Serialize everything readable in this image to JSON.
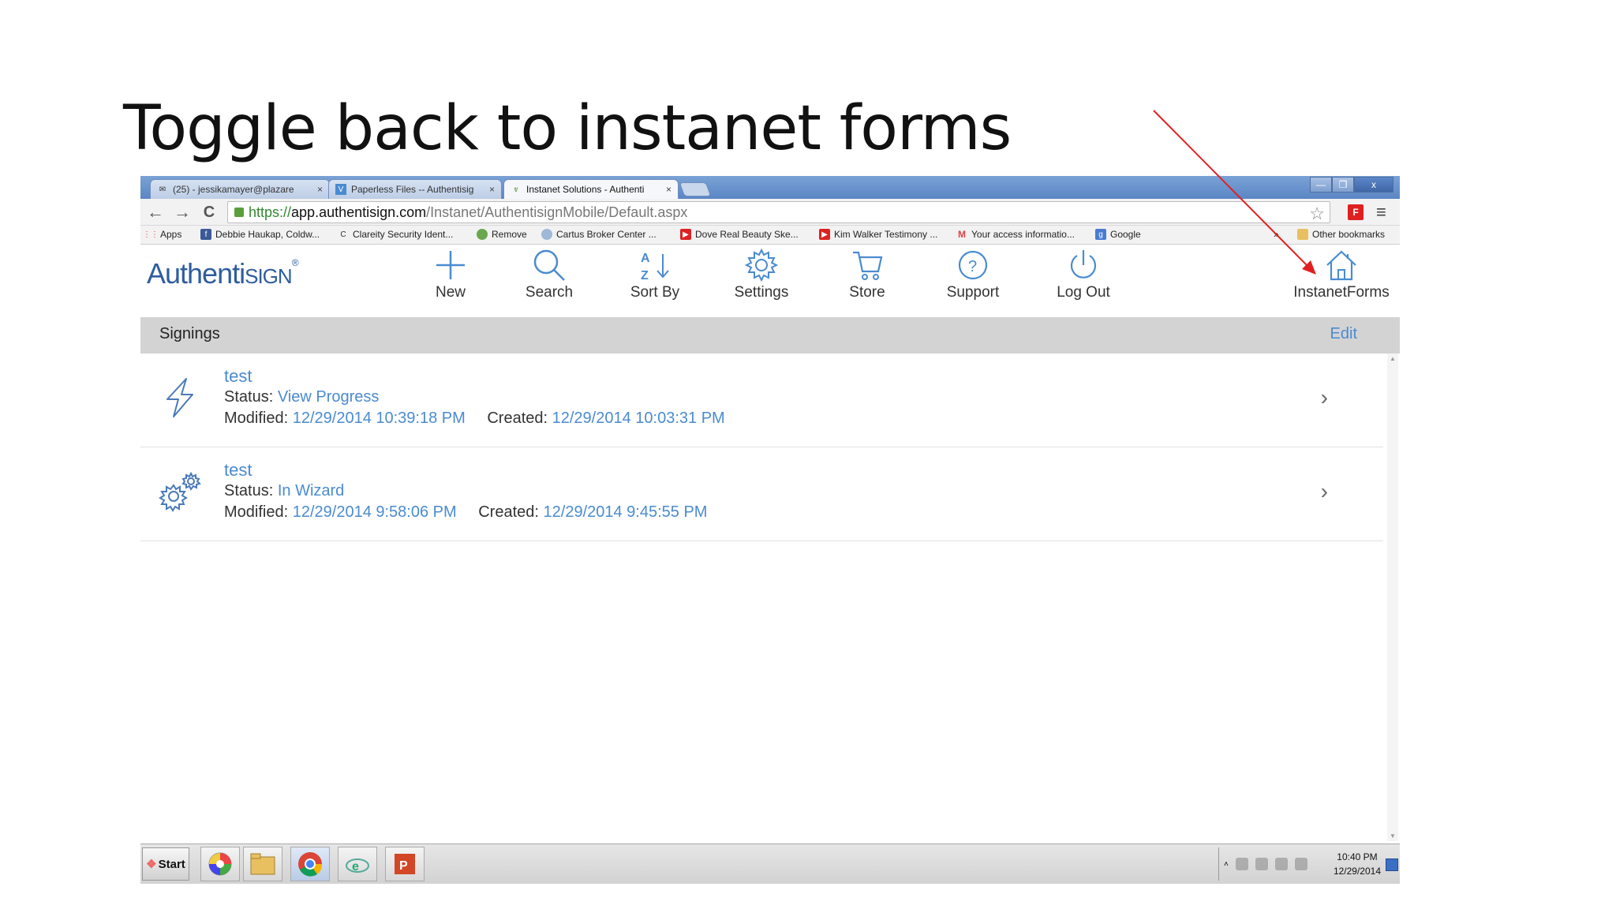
{
  "slide": {
    "title": "Toggle back to instanet forms"
  },
  "browser": {
    "tabs": [
      {
        "label": "(25) - jessikamayer@plazare",
        "close": "×"
      },
      {
        "label": "Paperless Files -- Authentisig",
        "close": "×"
      },
      {
        "label": "Instanet Solutions - Authenti",
        "close": "×"
      }
    ],
    "window_controls": {
      "minimize": "—",
      "restore": "❐",
      "close": "x"
    },
    "nav": {
      "back": "←",
      "forward": "→",
      "reload": "C"
    },
    "url": {
      "protocol": "https://",
      "host": "app.authentisign.com",
      "path": "/Instanet/AuthentisignMobile/Default.aspx"
    },
    "bookmarks": [
      "Apps",
      "Debbie Haukap, Coldw...",
      "Clareity Security Ident...",
      "Remove",
      "Cartus Broker Center ...",
      "Dove Real Beauty Ske...",
      "Kim Walker Testimony ...",
      "Your access informatio...",
      "Google"
    ],
    "bookmarks_overflow": "»",
    "other_bookmarks": "Other bookmarks"
  },
  "app": {
    "logo_main": "Authenti",
    "logo_sign": "SIGN",
    "nav": [
      {
        "label": "New",
        "icon": "plus-icon"
      },
      {
        "label": "Search",
        "icon": "search-icon"
      },
      {
        "label": "Sort By",
        "icon": "sort-az-icon"
      },
      {
        "label": "Settings",
        "icon": "gear-icon"
      },
      {
        "label": "Store",
        "icon": "cart-icon"
      },
      {
        "label": "Support",
        "icon": "help-icon"
      },
      {
        "label": "Log Out",
        "icon": "power-icon"
      },
      {
        "label": "InstanetForms",
        "icon": "home-icon"
      }
    ],
    "signings_title": "Signings",
    "edit_label": "Edit",
    "signings": [
      {
        "name": "test",
        "status_label": "Status:",
        "status": "View Progress",
        "modified_label": "Modified:",
        "modified": "12/29/2014 10:39:18 PM",
        "created_label": "Created:",
        "created": "12/29/2014 10:03:31 PM",
        "icon": "lightning-icon"
      },
      {
        "name": "test",
        "status_label": "Status:",
        "status": "In Wizard",
        "modified_label": "Modified:",
        "modified": "12/29/2014 9:58:06 PM",
        "created_label": "Created:",
        "created": "12/29/2014 9:45:55 PM",
        "icon": "gears-icon"
      }
    ],
    "chevron": "›"
  },
  "taskbar": {
    "start_label": "Start",
    "clock_time": "10:40 PM",
    "clock_date": "12/29/2014"
  },
  "annotation": {
    "arrow_color": "#e02020"
  }
}
